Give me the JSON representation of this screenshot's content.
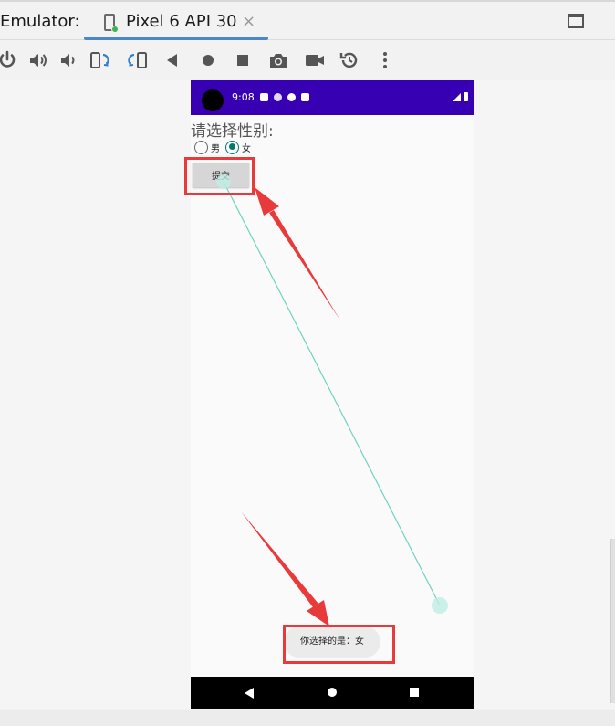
{
  "ide": {
    "tool_window_label": "Emulator:",
    "device_tab_title": "Pixel 6 API 30",
    "tab_close_glyph": "×",
    "accent_color": "#4a86c8",
    "toolbar_icons": [
      "power-icon",
      "volume-up-icon",
      "volume-down-icon",
      "rotate-left-icon",
      "rotate-right-icon",
      "back-icon",
      "home-icon",
      "overview-icon",
      "camera-icon",
      "screen-record-icon",
      "snapshot-icon",
      "more-icon"
    ]
  },
  "device": {
    "status_bar": {
      "time": "9:08",
      "color": "#3700b3"
    },
    "app": {
      "prompt": "请选择性别:",
      "radio_options": [
        {
          "label": "男",
          "checked": false
        },
        {
          "label": "女",
          "checked": true
        }
      ],
      "submit_button_label": "提交",
      "toast_message": "你选择的是：女",
      "radio_accent_color": "#00796b"
    }
  },
  "annotations": {
    "highlight_color": "#e83a3a",
    "trace_color": "#6fd3c0"
  }
}
